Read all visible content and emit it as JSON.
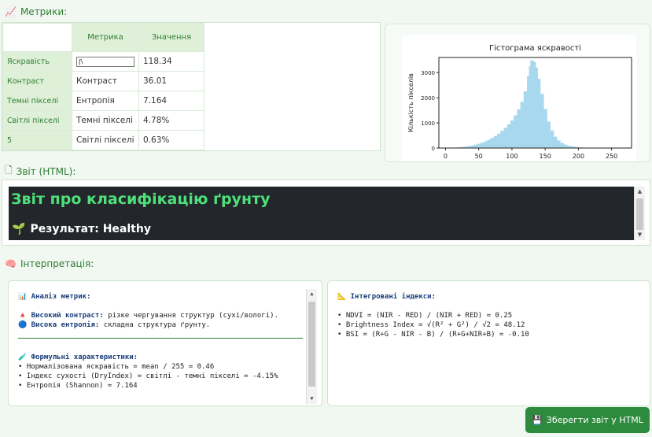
{
  "sections": {
    "metrics_title": "Метрики:",
    "report_title": "Звіт (HTML):",
    "interp_title": "Інтерпретація:"
  },
  "metrics_table": {
    "headers": [
      "Метрика",
      "Значення"
    ],
    "rows": [
      {
        "label": "Яскравість",
        "metric": "ʃ\\",
        "value": "118.34"
      },
      {
        "label": "Контраст",
        "metric": "Контраст",
        "value": "36.01"
      },
      {
        "label": "Темні пікселі",
        "metric": "Ентропія",
        "value": "7.164"
      },
      {
        "label": "Світлі пікселі",
        "metric": "Темні пікселі",
        "value": "4.78%"
      },
      {
        "label": "5",
        "metric": "Світлі пікселі",
        "value": "0.63%"
      }
    ]
  },
  "chart_data": {
    "type": "bar",
    "title": "Гістограма яскравості",
    "ylabel": "Кількість пікселів",
    "xlabel": "",
    "xlim": [
      -10,
      280
    ],
    "ylim": [
      0,
      3600
    ],
    "xticks": [
      0,
      50,
      100,
      150,
      200,
      250
    ],
    "yticks": [
      0,
      1000,
      2000,
      3000
    ],
    "bar_color": "#a8d8ee",
    "bins": [
      [
        5,
        5
      ],
      [
        10,
        12
      ],
      [
        15,
        20
      ],
      [
        20,
        30
      ],
      [
        25,
        42
      ],
      [
        30,
        58
      ],
      [
        35,
        78
      ],
      [
        40,
        102
      ],
      [
        45,
        135
      ],
      [
        50,
        170
      ],
      [
        55,
        215
      ],
      [
        60,
        265
      ],
      [
        65,
        330
      ],
      [
        70,
        400
      ],
      [
        75,
        480
      ],
      [
        80,
        570
      ],
      [
        85,
        680
      ],
      [
        90,
        800
      ],
      [
        95,
        940
      ],
      [
        100,
        1100
      ],
      [
        105,
        1300
      ],
      [
        110,
        1540
      ],
      [
        115,
        1840
      ],
      [
        120,
        2250
      ],
      [
        125,
        2850
      ],
      [
        128,
        3250
      ],
      [
        130,
        3480
      ],
      [
        133,
        3420
      ],
      [
        136,
        3200
      ],
      [
        140,
        2750
      ],
      [
        145,
        2150
      ],
      [
        150,
        1550
      ],
      [
        155,
        1050
      ],
      [
        160,
        700
      ],
      [
        165,
        450
      ],
      [
        170,
        300
      ],
      [
        175,
        200
      ],
      [
        180,
        140
      ],
      [
        185,
        95
      ],
      [
        190,
        70
      ],
      [
        195,
        50
      ],
      [
        200,
        35
      ],
      [
        205,
        22
      ],
      [
        210,
        12
      ],
      [
        215,
        6
      ],
      [
        220,
        3
      ]
    ]
  },
  "report": {
    "heading": "Звіт про класифікацію ґрунту",
    "result": "Результат: Healthy",
    "result_icon": "seedling-icon"
  },
  "interp_left": {
    "header": "Аналіз метрик:",
    "lines": [
      {
        "bold": "Високий контраст:",
        "text": " різке чергування структур (сухі/вологі)."
      },
      {
        "bold": "Висока ентропія:",
        "text": " складна структура ґрунту."
      }
    ],
    "formula_header": "Формульні характеристики:",
    "formulas": [
      "• Нормалізована яскравість = mean / 255 = 0.46",
      "• Індекс сухості (DryIndex) = світлі - темні пікселі = -4.15%",
      "• Ентропія (Shannon) ≈ 7.164"
    ]
  },
  "interp_right": {
    "header": "Інтегровані індекси:",
    "lines": [
      "• NDVI = (NIR - RED) / (NIR + RED) = 0.25",
      "• Brightness Index = √(R² + G²) / √2 = 48.12",
      "• BSI = (R+G - NIR - B) / (R+G+NIR+B) = -0.10"
    ]
  },
  "save_button": "Зберегти звіт у HTML"
}
